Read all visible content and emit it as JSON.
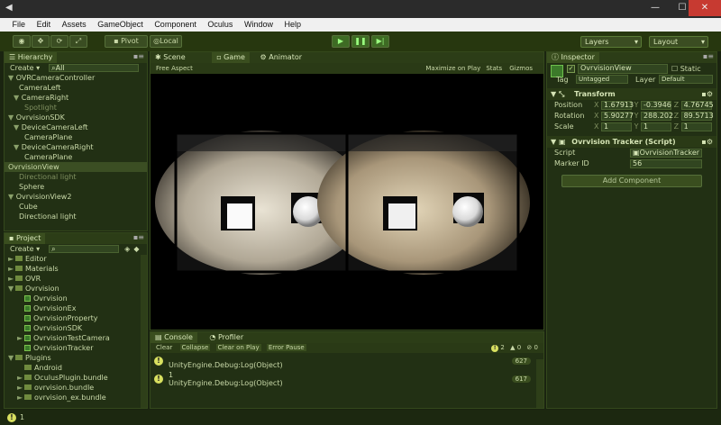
{
  "titlebar": {
    "close_glyph": "✕",
    "minimize_glyph": "—",
    "maximize_glyph": "☐",
    "close_color": "#c73a31"
  },
  "menu": [
    "File",
    "Edit",
    "Assets",
    "GameObject",
    "Component",
    "Oculus",
    "Window",
    "Help"
  ],
  "toolbar": {
    "pivot": "Pivot",
    "local": "Local",
    "layers": "Layers",
    "layout": "Layout"
  },
  "hierarchy": {
    "title": "Hierarchy",
    "create": "Create",
    "search": "All",
    "items": [
      {
        "label": "OVRCameraController",
        "indent": 0,
        "fold": "▼",
        "dim": false,
        "sel": false
      },
      {
        "label": "CameraLeft",
        "indent": 2,
        "fold": "",
        "dim": false,
        "sel": false
      },
      {
        "label": "CameraRight",
        "indent": 1,
        "fold": "▼",
        "dim": false,
        "sel": false
      },
      {
        "label": "Spotlight",
        "indent": 3,
        "fold": "",
        "dim": true,
        "sel": false
      },
      {
        "label": "OvrvisionSDK",
        "indent": 0,
        "fold": "▼",
        "dim": false,
        "sel": false
      },
      {
        "label": "DeviceCameraLeft",
        "indent": 1,
        "fold": "▼",
        "dim": false,
        "sel": false
      },
      {
        "label": "CameraPlane",
        "indent": 3,
        "fold": "",
        "dim": false,
        "sel": false
      },
      {
        "label": "DeviceCameraRight",
        "indent": 1,
        "fold": "▼",
        "dim": false,
        "sel": false
      },
      {
        "label": "CameraPlane",
        "indent": 3,
        "fold": "",
        "dim": false,
        "sel": false
      },
      {
        "label": "OvrvisionView",
        "indent": 0,
        "fold": "",
        "dim": false,
        "sel": true
      },
      {
        "label": "Directional light",
        "indent": 2,
        "fold": "",
        "dim": true,
        "sel": false
      },
      {
        "label": "Sphere",
        "indent": 2,
        "fold": "",
        "dim": false,
        "sel": false
      },
      {
        "label": "OvrvisionView2",
        "indent": 0,
        "fold": "▼",
        "dim": false,
        "sel": false
      },
      {
        "label": "Cube",
        "indent": 2,
        "fold": "",
        "dim": false,
        "sel": false
      },
      {
        "label": "Directional light",
        "indent": 2,
        "fold": "",
        "dim": false,
        "sel": false
      }
    ]
  },
  "project": {
    "title": "Project",
    "create": "Create",
    "items": [
      {
        "label": "Editor",
        "indent": 0,
        "type": "folder",
        "fold": "►"
      },
      {
        "label": "Materials",
        "indent": 0,
        "type": "folder",
        "fold": "►"
      },
      {
        "label": "OVR",
        "indent": 0,
        "type": "folder",
        "fold": "►"
      },
      {
        "label": "Ovrvision",
        "indent": 0,
        "type": "folder",
        "fold": "▼"
      },
      {
        "label": "Ovrvision",
        "indent": 1,
        "type": "file",
        "fold": ""
      },
      {
        "label": "OvrvisionEx",
        "indent": 1,
        "type": "file",
        "fold": ""
      },
      {
        "label": "OvrvisionProperty",
        "indent": 1,
        "type": "file",
        "fold": ""
      },
      {
        "label": "OvrvisionSDK",
        "indent": 1,
        "type": "file",
        "fold": ""
      },
      {
        "label": "OvrvisionTestCamera",
        "indent": 1,
        "type": "file",
        "fold": "►"
      },
      {
        "label": "OvrvisionTracker",
        "indent": 1,
        "type": "file",
        "fold": ""
      },
      {
        "label": "Plugins",
        "indent": 0,
        "type": "folder",
        "fold": "▼"
      },
      {
        "label": "Android",
        "indent": 1,
        "type": "folder",
        "fold": ""
      },
      {
        "label": "OculusPlugin.bundle",
        "indent": 1,
        "type": "folder",
        "fold": "►"
      },
      {
        "label": "ovrvision.bundle",
        "indent": 1,
        "type": "folder",
        "fold": "►"
      },
      {
        "label": "ovrvision_ex.bundle",
        "indent": 1,
        "type": "folder",
        "fold": "►"
      }
    ]
  },
  "scene_tab": "Scene",
  "game_tab": "Game",
  "animator_tab": "Animator",
  "game": {
    "aspect": "Free Aspect",
    "max_play": "Maximize on Play",
    "stats": "Stats",
    "gizmos": "Gizmos"
  },
  "console": {
    "title": "Console",
    "profiler": "Profiler",
    "clear": "Clear",
    "collapse": "Collapse",
    "clear_on_play": "Clear on Play",
    "error_pause": "Error Pause",
    "count_info": "2",
    "count_warn": "0",
    "count_err": "0",
    "entries": [
      {
        "line1": "",
        "line2": "UnityEngine.Debug:Log(Object)",
        "count": "627"
      },
      {
        "line1": "1",
        "line2": "UnityEngine.Debug:Log(Object)",
        "count": "617"
      }
    ]
  },
  "inspector": {
    "title": "Inspector",
    "object": "OvrvisionView",
    "static": "Static",
    "tag_label": "Tag",
    "tag": "Untagged",
    "layer_label": "Layer",
    "layer": "Default",
    "transform": "Transform",
    "position": "Position",
    "rotation": "Rotation",
    "scale": "Scale",
    "pos": {
      "x": "1.67913",
      "y": "-0.3946",
      "z": "4.76745"
    },
    "rot": {
      "x": "5.90277",
      "y": "288.202",
      "z": "89.5713"
    },
    "scl": {
      "x": "1",
      "y": "1",
      "z": "1"
    },
    "tracker": "Ovrvision Tracker (Script)",
    "script_label": "Script",
    "script": "OvrvisionTracker",
    "marker_label": "Marker ID",
    "marker": "56",
    "add": "Add Component"
  },
  "status": "1"
}
